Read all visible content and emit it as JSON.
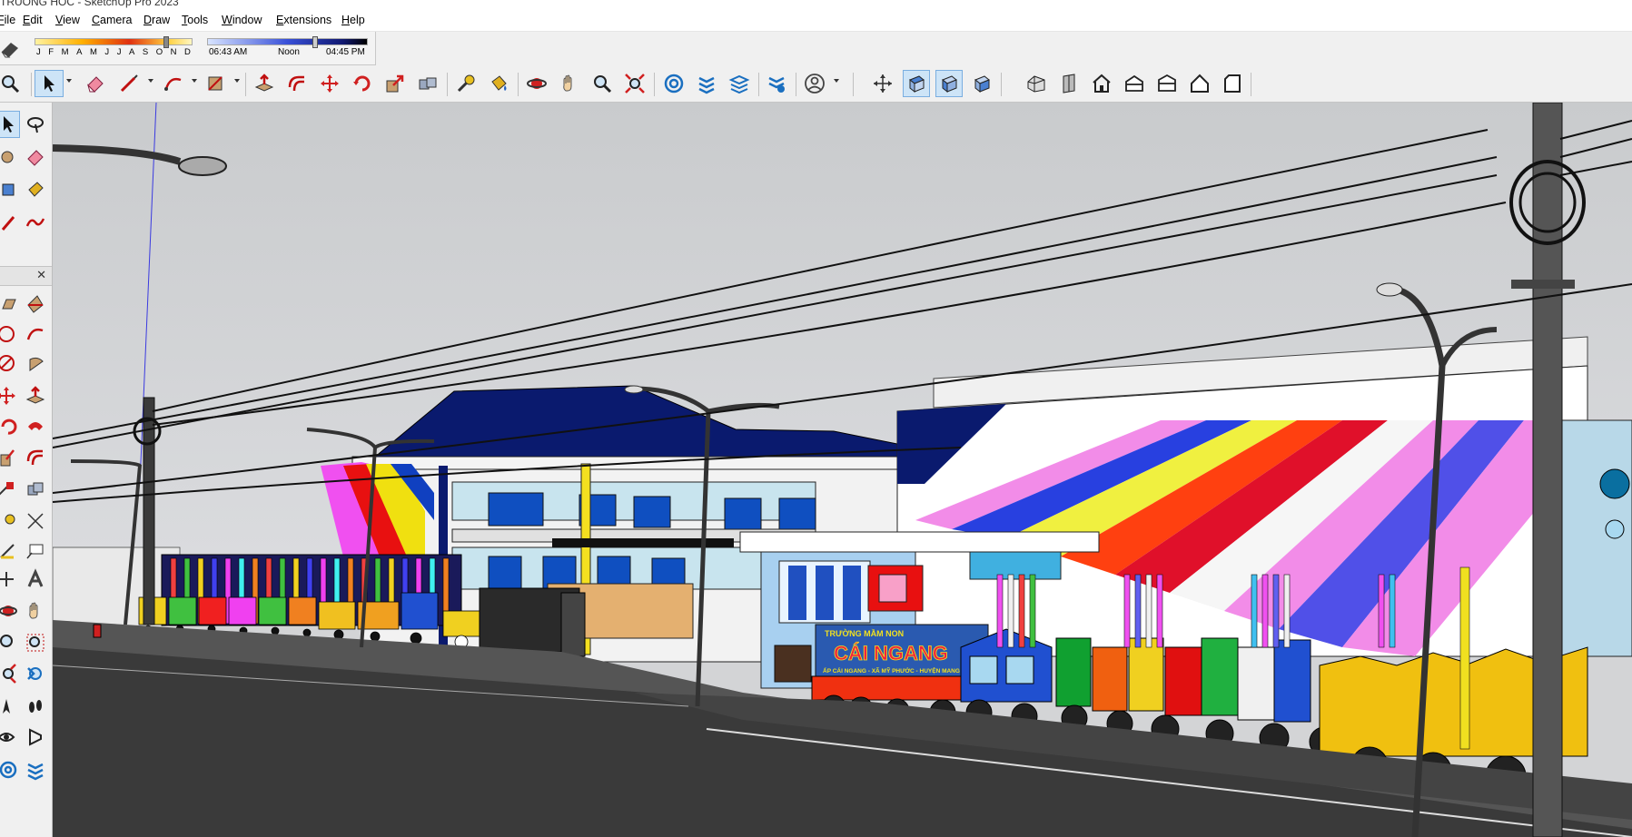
{
  "window": {
    "title": "TRUONG HOC - SketchUp Pro 2023"
  },
  "menu": {
    "items": [
      "File",
      "Edit",
      "View",
      "Camera",
      "Draw",
      "Tools",
      "Window",
      "Extensions",
      "Help"
    ]
  },
  "shadows": {
    "months": [
      "J",
      "F",
      "M",
      "A",
      "M",
      "J",
      "J",
      "A",
      "S",
      "O",
      "N",
      "D"
    ],
    "month_position": 0.84,
    "time_start": "06:43 AM",
    "time_mid": "Noon",
    "time_end": "04:45 PM",
    "time_position": 0.67
  },
  "toolbar": {
    "tools": [
      "zoom-icon",
      "select-icon",
      "eraser-icon",
      "line-icon",
      "arc-icon",
      "rectangle-icon",
      "push-pull-icon",
      "offset-icon",
      "move-icon",
      "rotate-icon",
      "scale-icon",
      "follow-me-icon",
      "tape-measure-icon",
      "paint-bucket-icon",
      "orbit-icon",
      "pan-icon",
      "zoom-tool-icon",
      "zoom-extents-icon",
      "warehouse-icon",
      "extension-warehouse-icon",
      "layout-icon",
      "extension-manager-icon",
      "account-icon",
      "iso-view-icon",
      "top-view-icon",
      "front-view-icon",
      "right-view-icon",
      "house-iso-icon",
      "house-front-icon",
      "house-home-icon",
      "house-back-icon",
      "house-left-icon",
      "house-outline-icon",
      "standard-view-icon"
    ],
    "active_tool": "select-icon"
  },
  "scene": {
    "sign_top": "TRƯỜNG MẦM NON",
    "sign_main": "CÁI NGANG",
    "sign_sub": "ẤP CÁI NGANG - XÃ MỸ PHƯỚC - HUYỆN MANG THÍT",
    "colors": {
      "sky": "#d3d4d6",
      "roof": "#0a1a6e",
      "road": "#3a3a3a",
      "accent": "#4a90d9"
    }
  }
}
